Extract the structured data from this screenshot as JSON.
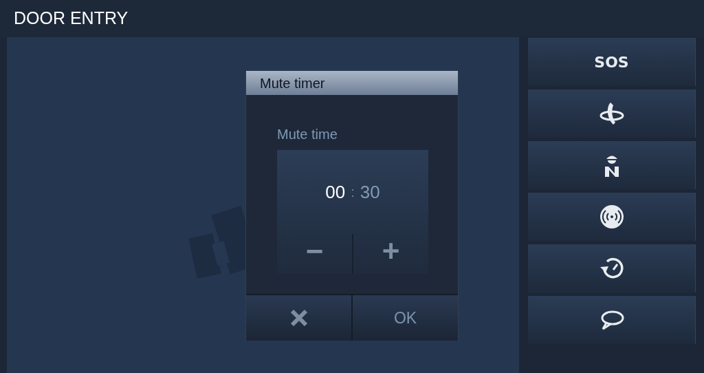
{
  "header": {
    "title": "DOOR ENTRY"
  },
  "dialog": {
    "title": "Mute timer",
    "label": "Mute time",
    "separator": ":",
    "fields": [
      {
        "value": "00",
        "selected": true
      },
      {
        "value": "30",
        "selected": false
      }
    ],
    "stepper": [
      "−",
      "+"
    ],
    "actions": [
      {
        "kind": "cancel"
      },
      {
        "kind": "ok",
        "label": "OK"
      }
    ]
  },
  "side_buttons": [
    {
      "kind": "text",
      "label": "SOS"
    },
    {
      "kind": "icon"
    },
    {
      "kind": "icon"
    },
    {
      "kind": "icon"
    },
    {
      "kind": "icon"
    },
    {
      "kind": "icon"
    }
  ]
}
